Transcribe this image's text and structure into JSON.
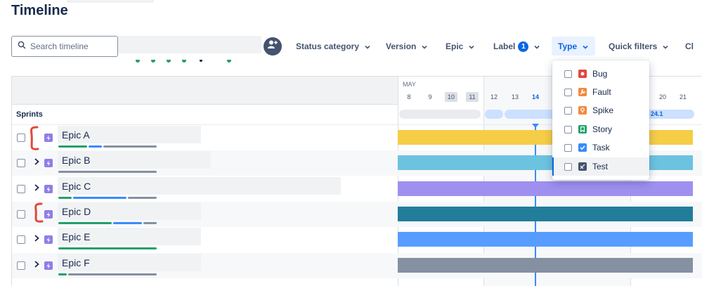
{
  "page": {
    "title": "Timeline"
  },
  "search": {
    "placeholder": "Search timeline"
  },
  "filters": [
    {
      "label": "Status category"
    },
    {
      "label": "Version"
    },
    {
      "label": "Epic"
    },
    {
      "label": "Label",
      "badge": "1"
    },
    {
      "label": "Type",
      "active": true
    },
    {
      "label": "Quick filters"
    },
    {
      "label": "Cl"
    }
  ],
  "timeline_header": {
    "month": "MAY",
    "days": [
      "8",
      "9",
      "10",
      "11",
      "12",
      "13",
      "14",
      "20",
      "21"
    ],
    "weekend_days": [
      "10",
      "11"
    ],
    "today": "14"
  },
  "sprints": {
    "label": "Sprints",
    "current_sprint_name": "24.1"
  },
  "epics": [
    {
      "name": "Epic A",
      "bar_color": "#f5cd47",
      "progress": {
        "done": 0.3,
        "in_progress": 0.15,
        "todo": 0.55
      }
    },
    {
      "name": "Epic B",
      "bar_color": "#6cc3e0",
      "progress": {
        "done": 0.0,
        "in_progress": 0.0,
        "todo": 1.0
      }
    },
    {
      "name": "Epic C",
      "bar_color": "#9f8fef",
      "progress": {
        "done": 0.15,
        "in_progress": 0.55,
        "todo": 0.3
      }
    },
    {
      "name": "Epic D",
      "bar_color": "#227d9b",
      "progress": {
        "done": 0.55,
        "in_progress": 0.3,
        "todo": 0.15
      }
    },
    {
      "name": "Epic E",
      "bar_color": "#579dff",
      "progress": {
        "done": 1.0,
        "in_progress": 0.0,
        "todo": 0.0
      }
    },
    {
      "name": "Epic F",
      "bar_color": "#8590a2",
      "progress": {
        "done": 0.1,
        "in_progress": 0.0,
        "todo": 0.9
      }
    }
  ],
  "type_dropdown": {
    "items": [
      {
        "label": "Bug",
        "icon": "bug-icon",
        "color": "#e2483d"
      },
      {
        "label": "Fault",
        "icon": "wrench-icon",
        "color": "#f38a3f"
      },
      {
        "label": "Spike",
        "icon": "lightbulb-icon",
        "color": "#f38a3f"
      },
      {
        "label": "Story",
        "icon": "bookmark-icon",
        "color": "#22a06b"
      },
      {
        "label": "Task",
        "icon": "checkmark-icon",
        "color": "#388bff"
      },
      {
        "label": "Test",
        "icon": "test-icon",
        "color": "#44546f"
      }
    ]
  },
  "colors": {
    "accent": "#0c66e4",
    "progress_done": "#22a06b",
    "progress_in_progress": "#388bff",
    "progress_todo": "#8590a2",
    "annotation": "#e2483d"
  }
}
